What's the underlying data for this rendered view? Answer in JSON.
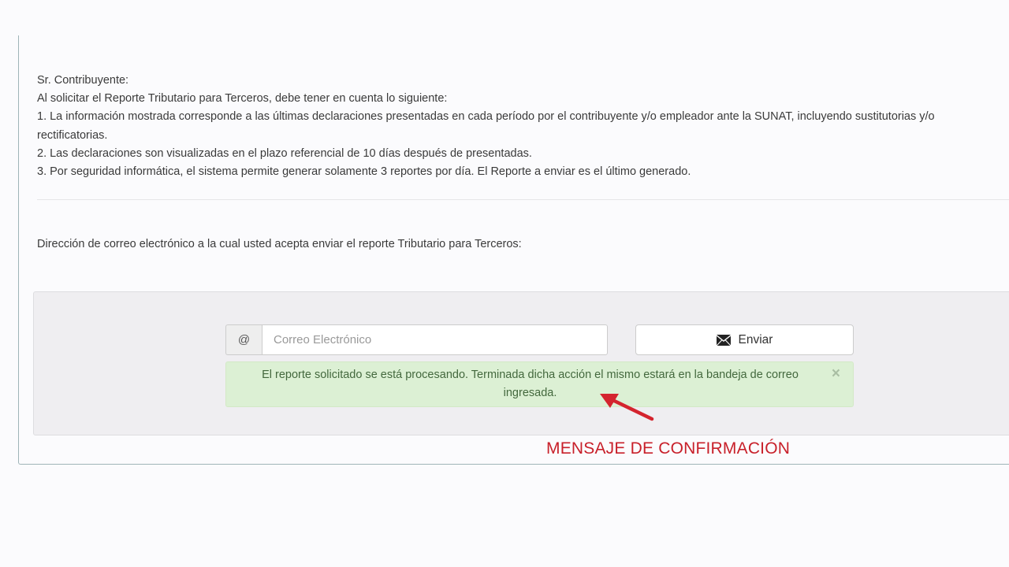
{
  "notice": {
    "greeting": "Sr. Contribuyente:",
    "intro": "Al solicitar el Reporte Tributario para Terceros, debe tener en cuenta lo siguiente:",
    "item1_line1": "1. La información mostrada corresponde a las últimas declaraciones presentadas en cada período por el contribuyente y/o empleador ante la SUNAT, incluyendo sustitutorias y/o",
    "item1_line2": "rectificatorias.",
    "item2": "2. Las declaraciones son visualizadas en el plazo referencial de 10 días después de presentadas.",
    "item3": "3. Por seguridad informática, el sistema permite generar solamente 3 reportes por día. El Reporte a enviar es el último generado."
  },
  "email_section": {
    "label": "Dirección de correo electrónico a la cual usted acepta enviar el reporte Tributario para Terceros:",
    "addon": "@",
    "placeholder": "Correo Electrónico",
    "value": "",
    "send_label": "Enviar",
    "send_icon": "envelope-icon"
  },
  "alert": {
    "message": "El reporte solicitado se está procesando. Terminada dicha acción el mismo estará en la bandeja de correo ingresada.",
    "close_symbol": "×",
    "color": "#43683d",
    "background": "#dcf0d4"
  },
  "annotation": {
    "text": "MENSAJE DE CONFIRMACIÓN",
    "color": "#c8202a",
    "icon": "arrow-icon"
  }
}
